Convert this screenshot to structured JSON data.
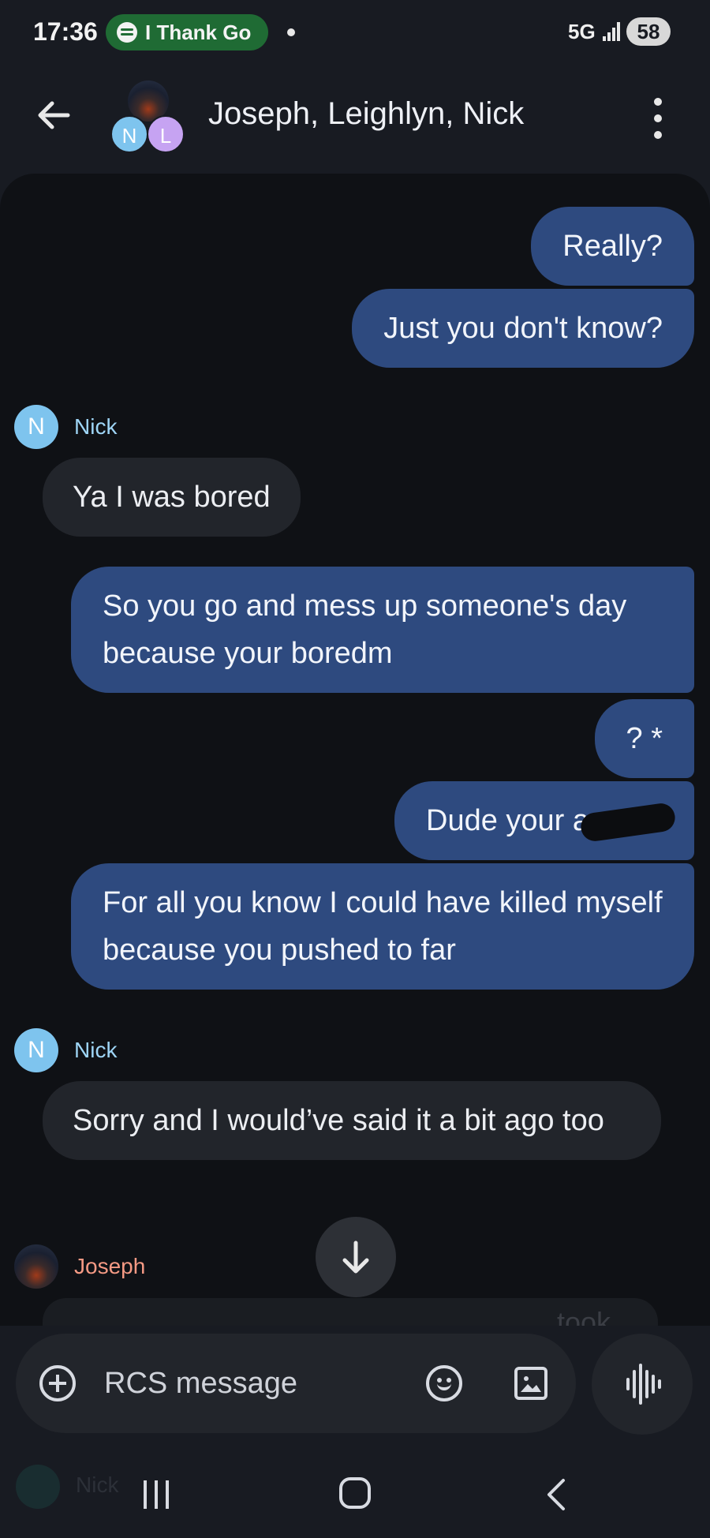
{
  "status_bar": {
    "time": "17:36",
    "media_pill_text": "I Thank Go",
    "network": "5G",
    "battery": "58"
  },
  "header": {
    "title": "Joseph, Leighlyn, Nick",
    "avatar_letters": [
      "N",
      "L"
    ]
  },
  "messages": [
    {
      "from": "me",
      "text": "Really?"
    },
    {
      "from": "me",
      "text": "Just you don't know?"
    },
    {
      "from": "Nick",
      "avatar": "N",
      "text": "Ya I was bored"
    },
    {
      "from": "me",
      "text": "So you go and mess up someone's day because your boredm"
    },
    {
      "from": "me",
      "text": "? *"
    },
    {
      "from": "me",
      "text": "Dude your a c"
    },
    {
      "from": "me",
      "text": "For all you know I could have killed myself because you pushed to far"
    },
    {
      "from": "Nick",
      "avatar": "N",
      "text": "Sorry and I would’ve said it a bit ago too"
    },
    {
      "from": "Joseph",
      "text": "took"
    }
  ],
  "senders": {
    "nick": "Nick",
    "joseph": "Joseph"
  },
  "compose": {
    "placeholder": "RCS message"
  },
  "nav": {
    "faded_name": "Nick"
  },
  "colors": {
    "outgoing_bubble": "#2e4a7f",
    "incoming_bubble": "#22252b",
    "nick_name": "#9fd6f7",
    "joseph_name": "#f59a84",
    "background": "#0f1115"
  },
  "icons": [
    "spotify-icon",
    "back-arrow-icon",
    "more-vert-icon",
    "arrow-down-icon",
    "add-circle-icon",
    "emoji-icon",
    "gallery-icon",
    "voice-waveform-icon",
    "recents-icon",
    "home-icon",
    "nav-back-icon"
  ]
}
